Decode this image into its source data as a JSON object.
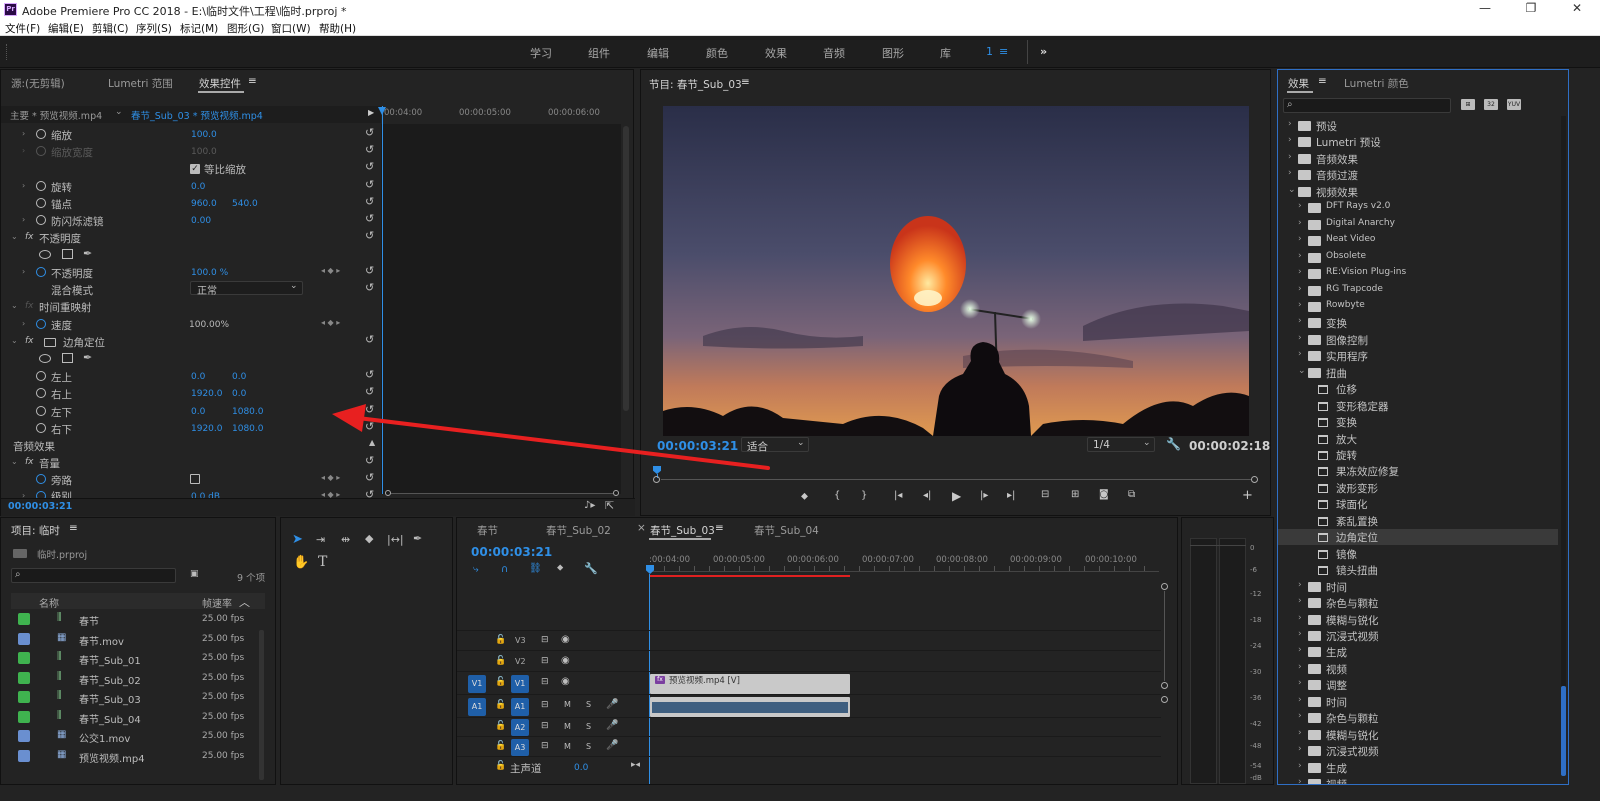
{
  "window": {
    "title": "Adobe Premiere Pro CC 2018 - E:\\临时文件\\工程\\临时.prproj *",
    "app_badge": "Pr"
  },
  "menu": [
    "文件(F)",
    "编辑(E)",
    "剪辑(C)",
    "序列(S)",
    "标记(M)",
    "图形(G)",
    "窗口(W)",
    "帮助(H)"
  ],
  "workspaces": [
    "学习",
    "组件",
    "编辑",
    "颜色",
    "效果",
    "音频",
    "图形",
    "库"
  ],
  "workspace_active_label": "1",
  "effect_controls": {
    "tabs": [
      "源:(无剪辑)",
      "Lumetri 范围",
      "效果控件"
    ],
    "master": "主要 * 预览视频.mp4",
    "sequence_clip": "春节_Sub_03 * 预览视频.mp4",
    "ruler": [
      "00:04:00",
      "00:00:05:00",
      "00:00:06:00"
    ],
    "rows": {
      "scale": {
        "label": "缩放",
        "v1": "100.0"
      },
      "scale_width": {
        "label": "缩放宽度",
        "v1": "100.0"
      },
      "uniform": {
        "label": "等比缩放"
      },
      "rotation": {
        "label": "旋转",
        "v1": "0.0"
      },
      "anchor": {
        "label": "锚点",
        "v1": "960.0",
        "v2": "540.0"
      },
      "flicker": {
        "label": "防闪烁滤镜",
        "v1": "0.00"
      },
      "opacity_group": {
        "label": "不透明度"
      },
      "opacity": {
        "label": "不透明度",
        "v1": "100.0 %"
      },
      "blend": {
        "label": "混合模式",
        "v1": "正常"
      },
      "time_remap": {
        "label": "时间重映射"
      },
      "speed": {
        "label": "速度",
        "v1": "100.00%"
      },
      "corner_pin": {
        "label": "边角定位"
      },
      "ul": {
        "label": "左上",
        "v1": "0.0",
        "v2": "0.0"
      },
      "ur": {
        "label": "右上",
        "v1": "1920.0",
        "v2": "0.0"
      },
      "ll": {
        "label": "左下",
        "v1": "0.0",
        "v2": "1080.0"
      },
      "lr": {
        "label": "右下",
        "v1": "1920.0",
        "v2": "1080.0"
      },
      "audio_effects": {
        "label": "音频效果"
      },
      "volume": {
        "label": "音量"
      },
      "bypass": {
        "label": "旁路"
      },
      "level": {
        "label": "级别",
        "v1": "0.0 dB"
      }
    },
    "timecode": "00:00:03:21"
  },
  "program": {
    "title": "节目: 春节_Sub_03",
    "timecode": "00:00:03:21",
    "fit": "适合",
    "resolution": "1/4",
    "duration": "00:00:02:18"
  },
  "effects_panel": {
    "tabs": [
      "效果",
      "Lumetri 颜色"
    ],
    "tree": [
      {
        "label": "预设",
        "level": 0,
        "type": "folder"
      },
      {
        "label": "Lumetri 预设",
        "level": 0,
        "type": "folder"
      },
      {
        "label": "音频效果",
        "level": 0,
        "type": "folder"
      },
      {
        "label": "音频过渡",
        "level": 0,
        "type": "folder"
      },
      {
        "label": "视频效果",
        "level": 0,
        "type": "folder",
        "open": true
      },
      {
        "label": "DFT Rays v2.0",
        "level": 1,
        "type": "folder"
      },
      {
        "label": "Digital Anarchy",
        "level": 1,
        "type": "folder"
      },
      {
        "label": "Neat Video",
        "level": 1,
        "type": "folder"
      },
      {
        "label": "Obsolete",
        "level": 1,
        "type": "folder"
      },
      {
        "label": "RE:Vision Plug-ins",
        "level": 1,
        "type": "folder"
      },
      {
        "label": "RG Trapcode",
        "level": 1,
        "type": "folder"
      },
      {
        "label": "Rowbyte",
        "level": 1,
        "type": "folder"
      },
      {
        "label": "变换",
        "level": 1,
        "type": "folder"
      },
      {
        "label": "图像控制",
        "level": 1,
        "type": "folder"
      },
      {
        "label": "实用程序",
        "level": 1,
        "type": "folder"
      },
      {
        "label": "扭曲",
        "level": 1,
        "type": "folder",
        "open": true
      },
      {
        "label": "位移",
        "level": 2,
        "type": "fx"
      },
      {
        "label": "变形稳定器",
        "level": 2,
        "type": "fx"
      },
      {
        "label": "变换",
        "level": 2,
        "type": "fx"
      },
      {
        "label": "放大",
        "level": 2,
        "type": "fx"
      },
      {
        "label": "旋转",
        "level": 2,
        "type": "fx"
      },
      {
        "label": "果冻效应修复",
        "level": 2,
        "type": "fx"
      },
      {
        "label": "波形变形",
        "level": 2,
        "type": "fx"
      },
      {
        "label": "球面化",
        "level": 2,
        "type": "fx"
      },
      {
        "label": "紊乱置换",
        "level": 2,
        "type": "fx"
      },
      {
        "label": "边角定位",
        "level": 2,
        "type": "fx",
        "selected": true
      },
      {
        "label": "镜像",
        "level": 2,
        "type": "fx"
      },
      {
        "label": "镜头扭曲",
        "level": 2,
        "type": "fx"
      },
      {
        "label": "时间",
        "level": 1,
        "type": "folder"
      },
      {
        "label": "杂色与颗粒",
        "level": 1,
        "type": "folder"
      },
      {
        "label": "模糊与锐化",
        "level": 1,
        "type": "folder"
      },
      {
        "label": "沉浸式视频",
        "level": 1,
        "type": "folder"
      },
      {
        "label": "生成",
        "level": 1,
        "type": "folder"
      },
      {
        "label": "视频",
        "level": 1,
        "type": "folder"
      },
      {
        "label": "调整",
        "level": 1,
        "type": "folder"
      },
      {
        "label": "时间",
        "level": 1,
        "type": "folder"
      },
      {
        "label": "杂色与颗粒",
        "level": 1,
        "type": "folder"
      },
      {
        "label": "模糊与锐化",
        "level": 1,
        "type": "folder"
      },
      {
        "label": "沉浸式视频",
        "level": 1,
        "type": "folder"
      },
      {
        "label": "生成",
        "level": 1,
        "type": "folder"
      },
      {
        "label": "视频",
        "level": 1,
        "type": "folder"
      }
    ]
  },
  "project": {
    "title": "项目: 临时",
    "file": "临时.prproj",
    "count": "9 个项",
    "col_name": "名称",
    "col_rate": "帧速率",
    "items": [
      {
        "name": "春节",
        "rate": "25.00 fps",
        "color": "#3fb34f",
        "kind": "seq"
      },
      {
        "name": "春节.mov",
        "rate": "25.00 fps",
        "color": "#6a8fd0",
        "kind": "clip"
      },
      {
        "name": "春节_Sub_01",
        "rate": "25.00 fps",
        "color": "#3fb34f",
        "kind": "seq"
      },
      {
        "name": "春节_Sub_02",
        "rate": "25.00 fps",
        "color": "#3fb34f",
        "kind": "seq"
      },
      {
        "name": "春节_Sub_03",
        "rate": "25.00 fps",
        "color": "#3fb34f",
        "kind": "seq"
      },
      {
        "name": "春节_Sub_04",
        "rate": "25.00 fps",
        "color": "#3fb34f",
        "kind": "seq"
      },
      {
        "name": "公交1.mov",
        "rate": "25.00 fps",
        "color": "#6a8fd0",
        "kind": "clip"
      },
      {
        "name": "预览视频.mp4",
        "rate": "25.00 fps",
        "color": "#6a8fd0",
        "kind": "clip"
      }
    ]
  },
  "timeline": {
    "tabs": [
      "春节",
      "春节_Sub_02",
      "春节_Sub_03",
      "春节_Sub_04"
    ],
    "active_tab": "春节_Sub_03",
    "timecode": "00:00:03:21",
    "ruler": [
      ":00:04:00",
      "00:00:05:00",
      "00:00:06:00",
      "00:00:07:00",
      "00:00:08:00",
      "00:00:09:00",
      "00:00:10:00"
    ],
    "tracks": {
      "v3": "V3",
      "v2": "V2",
      "v1": "V1",
      "a1": "A1",
      "a2": "A2",
      "a3": "A3",
      "src_v": "V1",
      "src_a": "A1"
    },
    "master": "主声道",
    "master_val": "0.0",
    "clip_label": "预览视频.mp4 [V]",
    "m": "M",
    "s": "S"
  },
  "meter": {
    "labels": [
      "0",
      "-6",
      "-12",
      "-18",
      "-24",
      "-30",
      "-36",
      "-42",
      "-48",
      "-54",
      "-dB"
    ]
  }
}
